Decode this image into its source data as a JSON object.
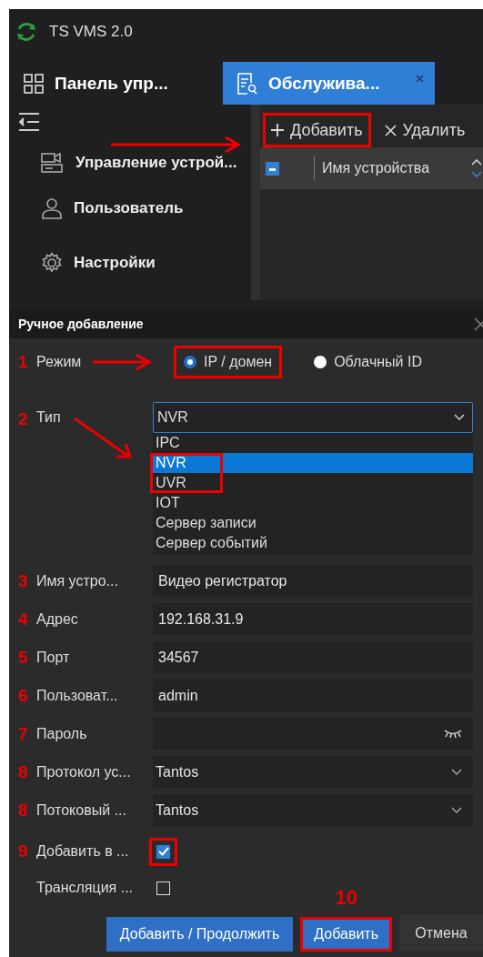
{
  "app": {
    "title": "TS VMS 2.0"
  },
  "header": {
    "panel_label": "Панель упр...",
    "tab": {
      "label": "Обслужива...",
      "selected": true
    }
  },
  "sidebar": {
    "items": [
      {
        "label": "Управление устрой..."
      },
      {
        "label": "Пользователь"
      },
      {
        "label": "Настройки"
      }
    ]
  },
  "toolbar": [
    {
      "label": "Добавить",
      "highlighted": true
    },
    {
      "label": "Удалить",
      "highlighted": false
    }
  ],
  "table": {
    "select_all_checked": true,
    "columns": [
      "Имя устройства"
    ]
  },
  "dialog": {
    "title": "Ручное добавление",
    "mode": {
      "step": "1",
      "label": "Режим",
      "options": [
        {
          "label": "IP / домен",
          "selected": true,
          "highlighted": true
        },
        {
          "label": "Облачный ID",
          "selected": false,
          "highlighted": false
        }
      ]
    },
    "type": {
      "step": "2",
      "label": "Тип",
      "value": "NVR",
      "expanded": true,
      "options": [
        {
          "label": "IPC",
          "selected": false,
          "highlighted": false
        },
        {
          "label": "NVR",
          "selected": true,
          "highlighted": true
        },
        {
          "label": "UVR",
          "selected": false,
          "highlighted": true
        },
        {
          "label": "IOT",
          "selected": false,
          "highlighted": false
        },
        {
          "label": "Сервер записи",
          "selected": false,
          "highlighted": false
        },
        {
          "label": "Сервер событий",
          "selected": false,
          "highlighted": false
        }
      ]
    },
    "fields": [
      {
        "step": "3",
        "label": "Имя устро...",
        "kind": "text",
        "value": "Видео регистратор"
      },
      {
        "step": "4",
        "label": "Адрес",
        "kind": "text",
        "value": "192.168.31.9"
      },
      {
        "step": "5",
        "label": "Порт",
        "kind": "text",
        "value": "34567"
      },
      {
        "step": "6",
        "label": "Пользоват...",
        "kind": "text",
        "value": "admin"
      },
      {
        "step": "7",
        "label": "Пароль",
        "kind": "password"
      },
      {
        "step": "8",
        "label": "Протокол ус...",
        "kind": "select",
        "value": "Tantos"
      },
      {
        "step": "8",
        "label": "Потоковый ...",
        "kind": "select",
        "value": "Tantos"
      }
    ],
    "checks": [
      {
        "step": "9",
        "label": "Добавить в ...",
        "checked": true,
        "highlighted": true
      },
      {
        "label": "Трансляция ...",
        "checked": false,
        "highlighted": false
      }
    ],
    "buttons": [
      {
        "label": "Добавить / Продолжить",
        "kind": "primary",
        "highlighted": false
      },
      {
        "label": "Добавить",
        "kind": "primary",
        "highlighted": true,
        "step": "10"
      },
      {
        "label": "Отмена",
        "kind": "secondary",
        "highlighted": false
      }
    ]
  }
}
